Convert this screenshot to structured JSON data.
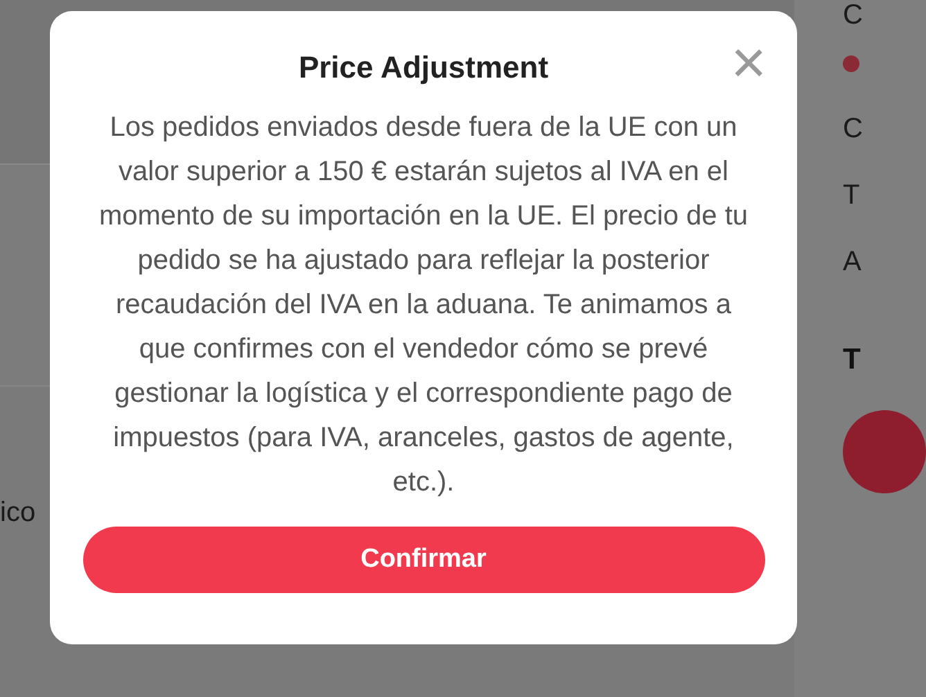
{
  "background": {
    "left_text": "ico",
    "right_texts": [
      "C",
      "C",
      "T",
      "A"
    ],
    "right_heading": "T"
  },
  "dialog": {
    "title": "Price Adjustment",
    "close": "×",
    "message": "Los pedidos enviados desde fuera de la UE con un valor superior a 150 € estarán sujetos al IVA en el momento de su importación en la UE. El precio de tu pedido se ha ajustado para reflejar la posterior recaudación del IVA en la aduana. Te animamos a que confirmes con el vendedor cómo se prevé gestionar la logística y el correspondiente pago de impuestos (para IVA, aranceles, gastos de agente, etc.).",
    "button": "Confirmar"
  }
}
